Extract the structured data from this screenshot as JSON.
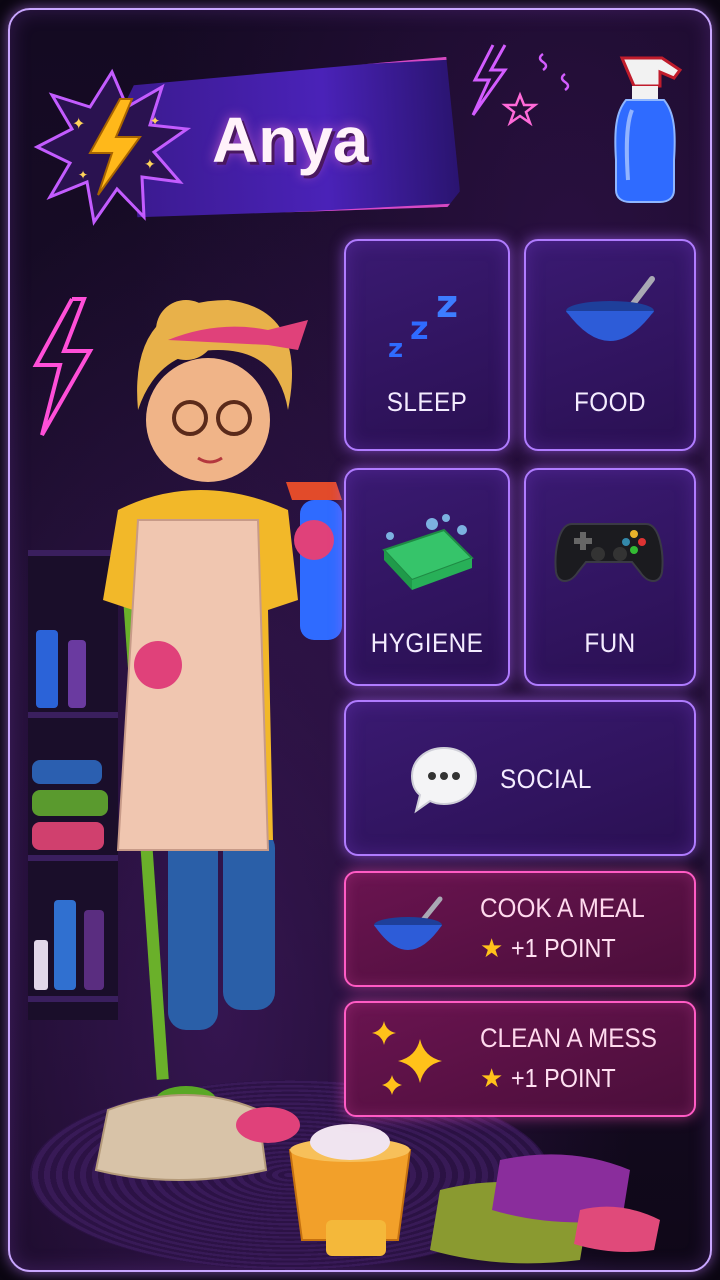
{
  "player": {
    "name": "Anya"
  },
  "needs": [
    {
      "id": "sleep",
      "label": "SLEEP",
      "icon": "zzz-icon"
    },
    {
      "id": "food",
      "label": "FOOD",
      "icon": "bowl-icon"
    },
    {
      "id": "hygiene",
      "label": "HYGIENE",
      "icon": "soap-icon"
    },
    {
      "id": "fun",
      "label": "FUN",
      "icon": "gamepad-icon"
    },
    {
      "id": "social",
      "label": "SOCIAL",
      "icon": "chat-bubble-icon"
    }
  ],
  "tasks": [
    {
      "title": "COOK A MEAL",
      "points": "+1 POINT",
      "icon": "bowl-icon"
    },
    {
      "title": "CLEAN A MESS",
      "points": "+1 POINT",
      "icon": "sparkles-icon"
    }
  ],
  "colors": {
    "tile_border": "#b07cff",
    "task_border": "#ff5bc4",
    "accent_blue": "#2f6bff",
    "star": "#ffc21a"
  }
}
